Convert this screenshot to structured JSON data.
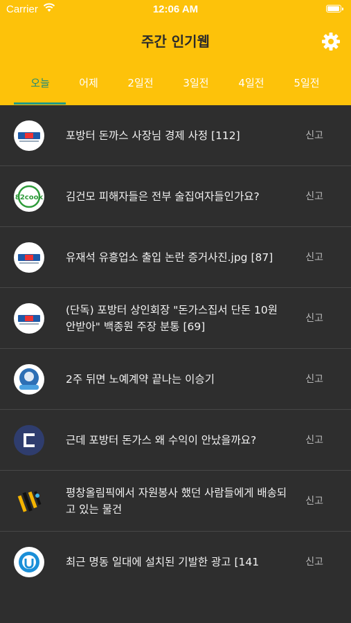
{
  "status_bar": {
    "carrier": "Carrier",
    "time": "12:06 AM"
  },
  "header": {
    "title": "주간 인기웹"
  },
  "tabs": [
    {
      "label": "오늘"
    },
    {
      "label": "어제"
    },
    {
      "label": "2일전"
    },
    {
      "label": "3일전"
    },
    {
      "label": "4일전"
    },
    {
      "label": "5일전"
    }
  ],
  "active_tab_index": 0,
  "colors": {
    "header_bg": "#fdc20a",
    "list_bg": "#2e2e2e",
    "accent": "#1f9a86"
  },
  "posts": [
    {
      "title": "포방터 돈까스 사장님 경제 사정 [112]",
      "report": "신고",
      "icon": "mlbpark-logo-icon"
    },
    {
      "title": "김건모 피해자들은 전부 술집여자들인가요?",
      "report": "신고",
      "icon": "82cook-logo-icon"
    },
    {
      "title": "유재석 유흥업소 출입 논란 증거사진.jpg [87]",
      "report": "신고",
      "icon": "mlbpark-logo-icon"
    },
    {
      "title": "(단독) 포방터 상인회장 \"돈가스집서 단돈 10원 안받아\" 백종원 주장 분통 [69]",
      "report": "신고",
      "icon": "mlbpark-logo-icon"
    },
    {
      "title": "2주 뒤면 노예계약 끝나는 이승기",
      "report": "신고",
      "icon": "dogdrip-logo-icon"
    },
    {
      "title": "근데 포방터 돈가스 왜 수익이 안났을까요?",
      "report": "신고",
      "icon": "clien-logo-icon"
    },
    {
      "title": "평창올림픽에서 자원봉사 했던 사람들에게 배송되고 있는 물건",
      "report": "신고",
      "icon": "bobaedream-logo-icon"
    },
    {
      "title": "최근 명동 일대에 설치된 기발한 광고 [141",
      "report": "신고",
      "icon": "humoruniv-logo-icon"
    }
  ]
}
